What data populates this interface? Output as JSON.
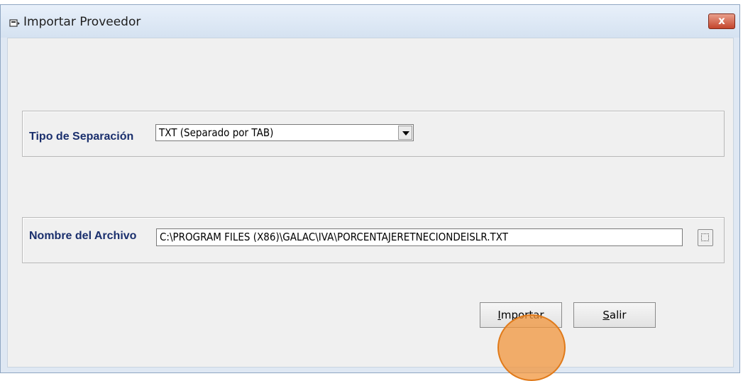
{
  "window": {
    "title": "Importar Proveedor",
    "close_glyph": "x"
  },
  "separation": {
    "label": "Tipo de Separación",
    "value": "TXT (Separado por TAB)"
  },
  "file": {
    "label": "Nombre del Archivo",
    "value": "C:\\PROGRAM FILES (X86)\\GALAC\\IVA\\PORCENTAJERETNECIONDEISLR.TXT"
  },
  "buttons": {
    "import_accel": "I",
    "import_rest": "mportar",
    "exit_accel": "S",
    "exit_rest": "alir"
  },
  "icons": {
    "app": "window-app-icon",
    "close": "close-icon",
    "dropdown": "chevron-down-icon",
    "browse": "browse-icon"
  },
  "colors": {
    "label_text": "#1a2f6d",
    "highlight": "#f2963c",
    "close_button": "#c4452c"
  }
}
